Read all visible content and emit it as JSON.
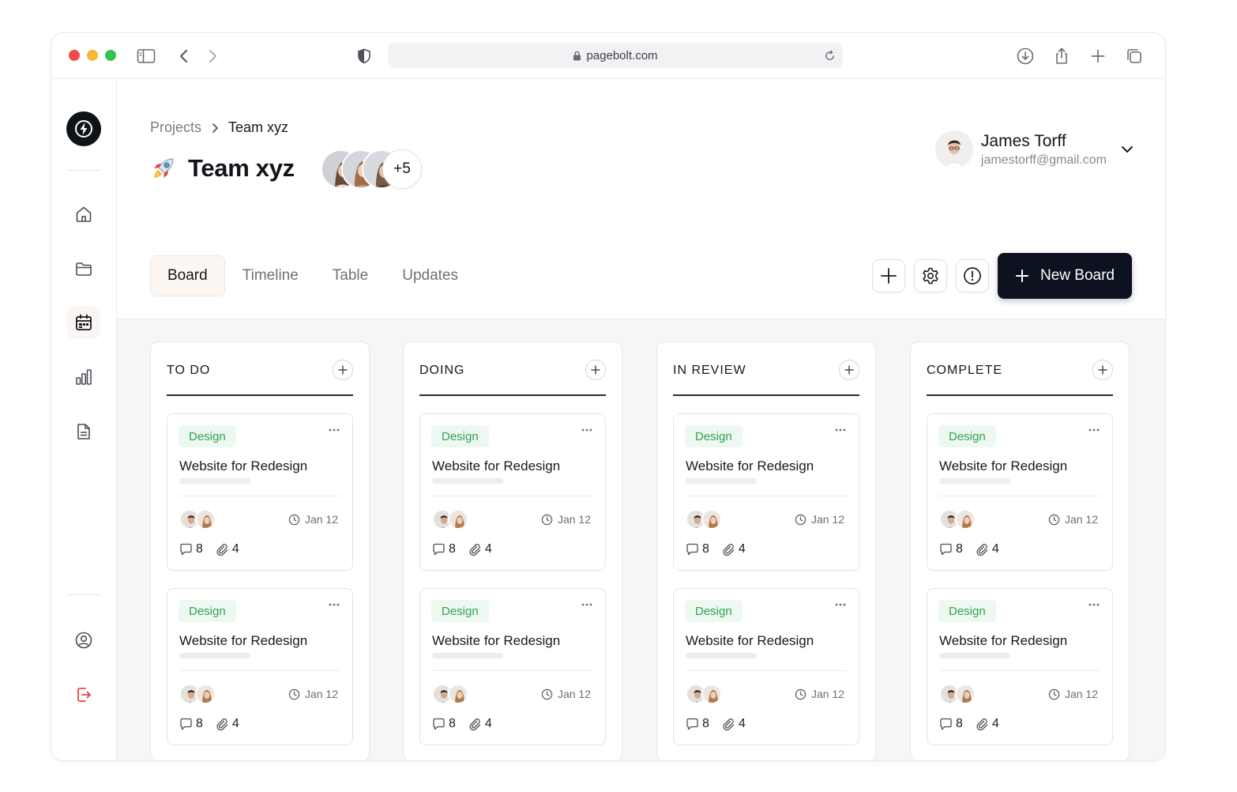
{
  "browser": {
    "url": "pagebolt.com"
  },
  "breadcrumb": {
    "root": "Projects",
    "current": "Team xyz"
  },
  "team": {
    "name": "Team xyz",
    "extra_members": "+5"
  },
  "user": {
    "name": "James Torff",
    "email": "jamestorff@gmail.com"
  },
  "tabs": [
    {
      "label": "Board",
      "active": true
    },
    {
      "label": "Timeline",
      "active": false
    },
    {
      "label": "Table",
      "active": false
    },
    {
      "label": "Updates",
      "active": false
    }
  ],
  "actions": {
    "new_board_label": "New Board"
  },
  "colors": {
    "primary_dark": "#0d1220",
    "tag_text": "#2fa352",
    "tag_bg": "#edf8f0",
    "logout_icon": "#e5484d"
  },
  "columns": [
    {
      "title": "TO DO",
      "cards": [
        {
          "tag": "Design",
          "title": "Website for Redesign",
          "due": "Jan 12",
          "comments": "8",
          "attachments": "4"
        },
        {
          "tag": "Design",
          "title": "Website for Redesign",
          "due": "Jan 12",
          "comments": "8",
          "attachments": "4"
        }
      ]
    },
    {
      "title": "DOING",
      "cards": [
        {
          "tag": "Design",
          "title": "Website for Redesign",
          "due": "Jan 12",
          "comments": "8",
          "attachments": "4"
        },
        {
          "tag": "Design",
          "title": "Website for Redesign",
          "due": "Jan 12",
          "comments": "8",
          "attachments": "4"
        }
      ]
    },
    {
      "title": "IN REVIEW",
      "cards": [
        {
          "tag": "Design",
          "title": "Website for Redesign",
          "due": "Jan 12",
          "comments": "8",
          "attachments": "4"
        },
        {
          "tag": "Design",
          "title": "Website for Redesign",
          "due": "Jan 12",
          "comments": "8",
          "attachments": "4"
        }
      ]
    },
    {
      "title": "COMPLETE",
      "cards": [
        {
          "tag": "Design",
          "title": "Website for Redesign",
          "due": "Jan 12",
          "comments": "8",
          "attachments": "4"
        },
        {
          "tag": "Design",
          "title": "Website for Redesign",
          "due": "Jan 12",
          "comments": "8",
          "attachments": "4"
        }
      ]
    }
  ]
}
